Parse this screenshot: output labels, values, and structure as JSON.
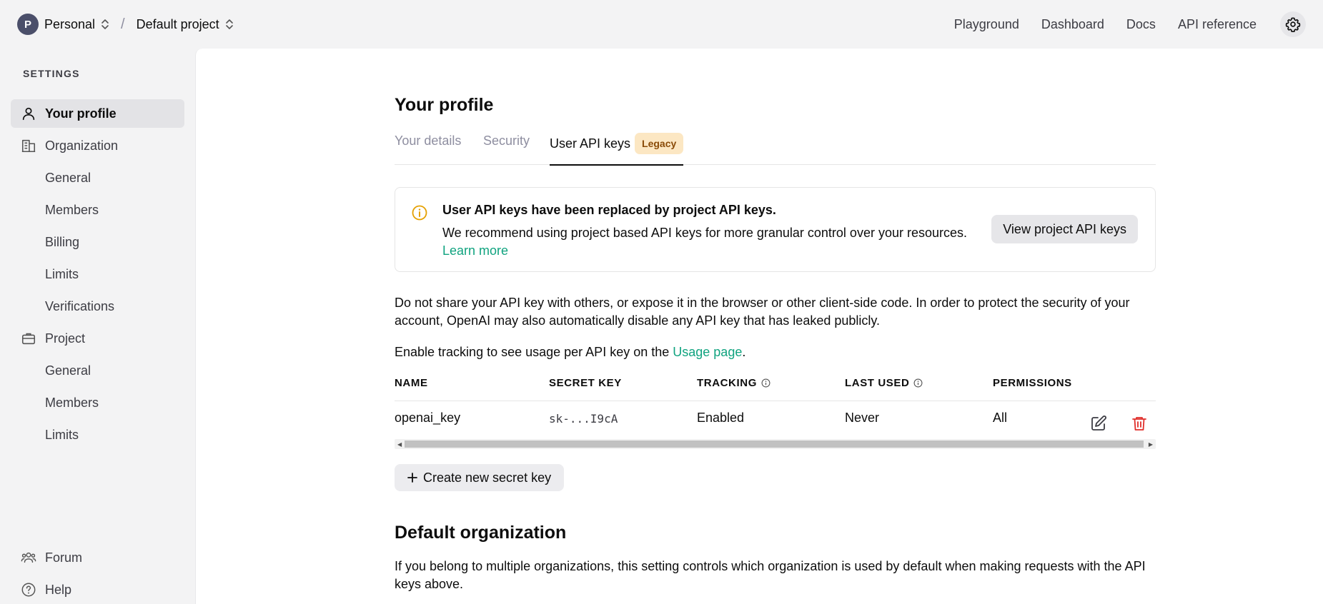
{
  "topbar": {
    "avatar_initial": "P",
    "workspace": "Personal",
    "separator": "/",
    "project": "Default project",
    "nav": [
      "Playground",
      "Dashboard",
      "Docs",
      "API reference"
    ]
  },
  "sidebar": {
    "heading": "SETTINGS",
    "items": [
      {
        "label": "Your profile",
        "icon": "person-icon"
      },
      {
        "label": "Organization",
        "icon": "building-icon"
      },
      {
        "label": "General"
      },
      {
        "label": "Members"
      },
      {
        "label": "Billing"
      },
      {
        "label": "Limits"
      },
      {
        "label": "Verifications"
      },
      {
        "label": "Project",
        "icon": "briefcase-icon"
      },
      {
        "label": "General"
      },
      {
        "label": "Members"
      },
      {
        "label": "Limits"
      },
      {
        "label": "Forum",
        "icon": "people-icon"
      },
      {
        "label": "Help",
        "icon": "question-icon"
      }
    ]
  },
  "main": {
    "title": "Your profile",
    "tabs": [
      "Your details",
      "Security",
      "User API keys"
    ],
    "tab_badge": "Legacy",
    "notice": {
      "title": "User API keys have been replaced by project API keys.",
      "body": "We recommend using project based API keys for more granular control over your resources.",
      "link": "Learn more",
      "button": "View project API keys"
    },
    "warning": "Do not share your API key with others, or expose it in the browser or other client-side code. In order to protect the security of your account, OpenAI may also automatically disable any API key that has leaked publicly.",
    "tracking_text": "Enable tracking to see usage per API key on the",
    "tracking_link": "Usage page",
    "tracking_end": ".",
    "table": {
      "headers": [
        "NAME",
        "SECRET KEY",
        "TRACKING",
        "LAST USED",
        "PERMISSIONS"
      ],
      "rows": [
        {
          "name": "openai_key",
          "secret": "sk-...I9cA",
          "tracking": "Enabled",
          "last_used": "Never",
          "permissions": "All"
        }
      ]
    },
    "create_button": "Create new secret key",
    "default_org_title": "Default organization",
    "default_org_text": "If you belong to multiple organizations, this setting controls which organization is used by default when making requests with the API keys above."
  },
  "colors": {
    "accent": "#10a37f",
    "danger": "#e02e2a",
    "badge_bg": "#fce7c3",
    "badge_text": "#8a4b08",
    "info": "#e5a000"
  }
}
